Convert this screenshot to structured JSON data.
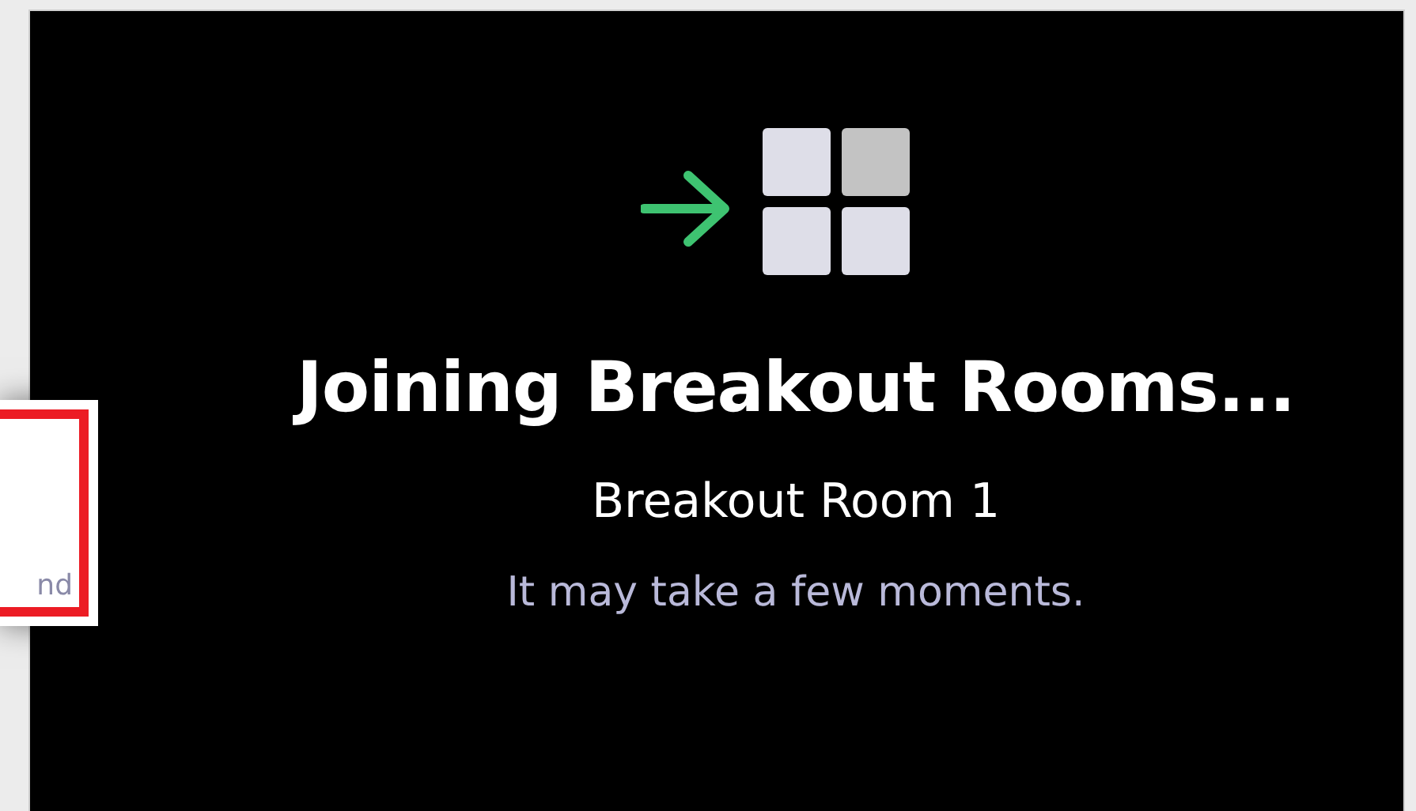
{
  "side_card": {
    "text": "nd"
  },
  "title": "Joining Breakout Rooms...",
  "room_name": "Breakout Room 1",
  "note": "It may take a few moments."
}
